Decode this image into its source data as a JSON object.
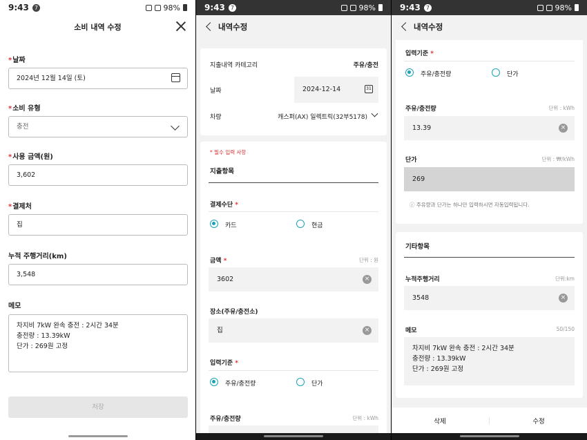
{
  "status": {
    "time": "9:43",
    "badge": "7",
    "battery": "98%",
    "network": "LTE"
  },
  "panel1": {
    "title": "소비 내역 수정",
    "date_label": "날짜",
    "date_value": "2024년 12월 14일 (토)",
    "type_label": "소비 유형",
    "type_value": "충전",
    "amount_label": "사용 금액(원)",
    "amount_value": "3,602",
    "payee_label": "결제처",
    "payee_value": "집",
    "mileage_label": "누적 주행거리(km)",
    "mileage_value": "3,548",
    "memo_label": "메모",
    "memo_lines": [
      "차지비 7kW 완속 충전 : 2시간 34분",
      "충전량 : 13.39kW",
      "단가 : 269원 고정"
    ],
    "save_label": "저장"
  },
  "panel2": {
    "title": "내역수정",
    "category_label": "지출내역 카테고리",
    "category_value": "주유/충전",
    "date_label": "날짜",
    "date_value": "2024-12-14",
    "cal_num": "31",
    "vehicle_label": "차량",
    "vehicle_value": "캐스퍼(AX) 일렉트릭(32부5178)",
    "required_note": "* 필수 입력 사항",
    "section_title": "지출항목",
    "payment_label": "결제수단",
    "payment_options": [
      "카드",
      "현금"
    ],
    "amount_label": "금액",
    "amount_unit": "단위 : 원",
    "amount_value": "3602",
    "place_label": "장소(주유/충전소)",
    "place_value": "집",
    "basis_label": "입력기준",
    "basis_options": [
      "주유/충전량",
      "단가"
    ],
    "volume_label": "주유/충전량",
    "volume_unit": "단위 : kWh"
  },
  "panel3": {
    "title": "내역수정",
    "basis_label": "입력기준",
    "basis_options": [
      "주유/충전량",
      "단가"
    ],
    "volume_label": "주유/충전량",
    "volume_unit": "단위 : kWh",
    "volume_value": "13.39",
    "price_label": "단가",
    "price_unit": "단위 : ₩/kWh",
    "price_value": "269",
    "hint": "주유량과 단가는 하나만 입력하시면 자동입력됩니다.",
    "etc_title": "기타항목",
    "mileage_label": "누적주행거리",
    "mileage_unit": "단위:km",
    "mileage_value": "3548",
    "memo_label": "메모",
    "memo_count": "50/150",
    "memo_lines": [
      "차지비 7kW 완속 충전 : 2시간 34분",
      "충전량 : 13.39kW",
      "단가 : 269원 고정"
    ],
    "delete_label": "삭제",
    "edit_label": "수정"
  }
}
